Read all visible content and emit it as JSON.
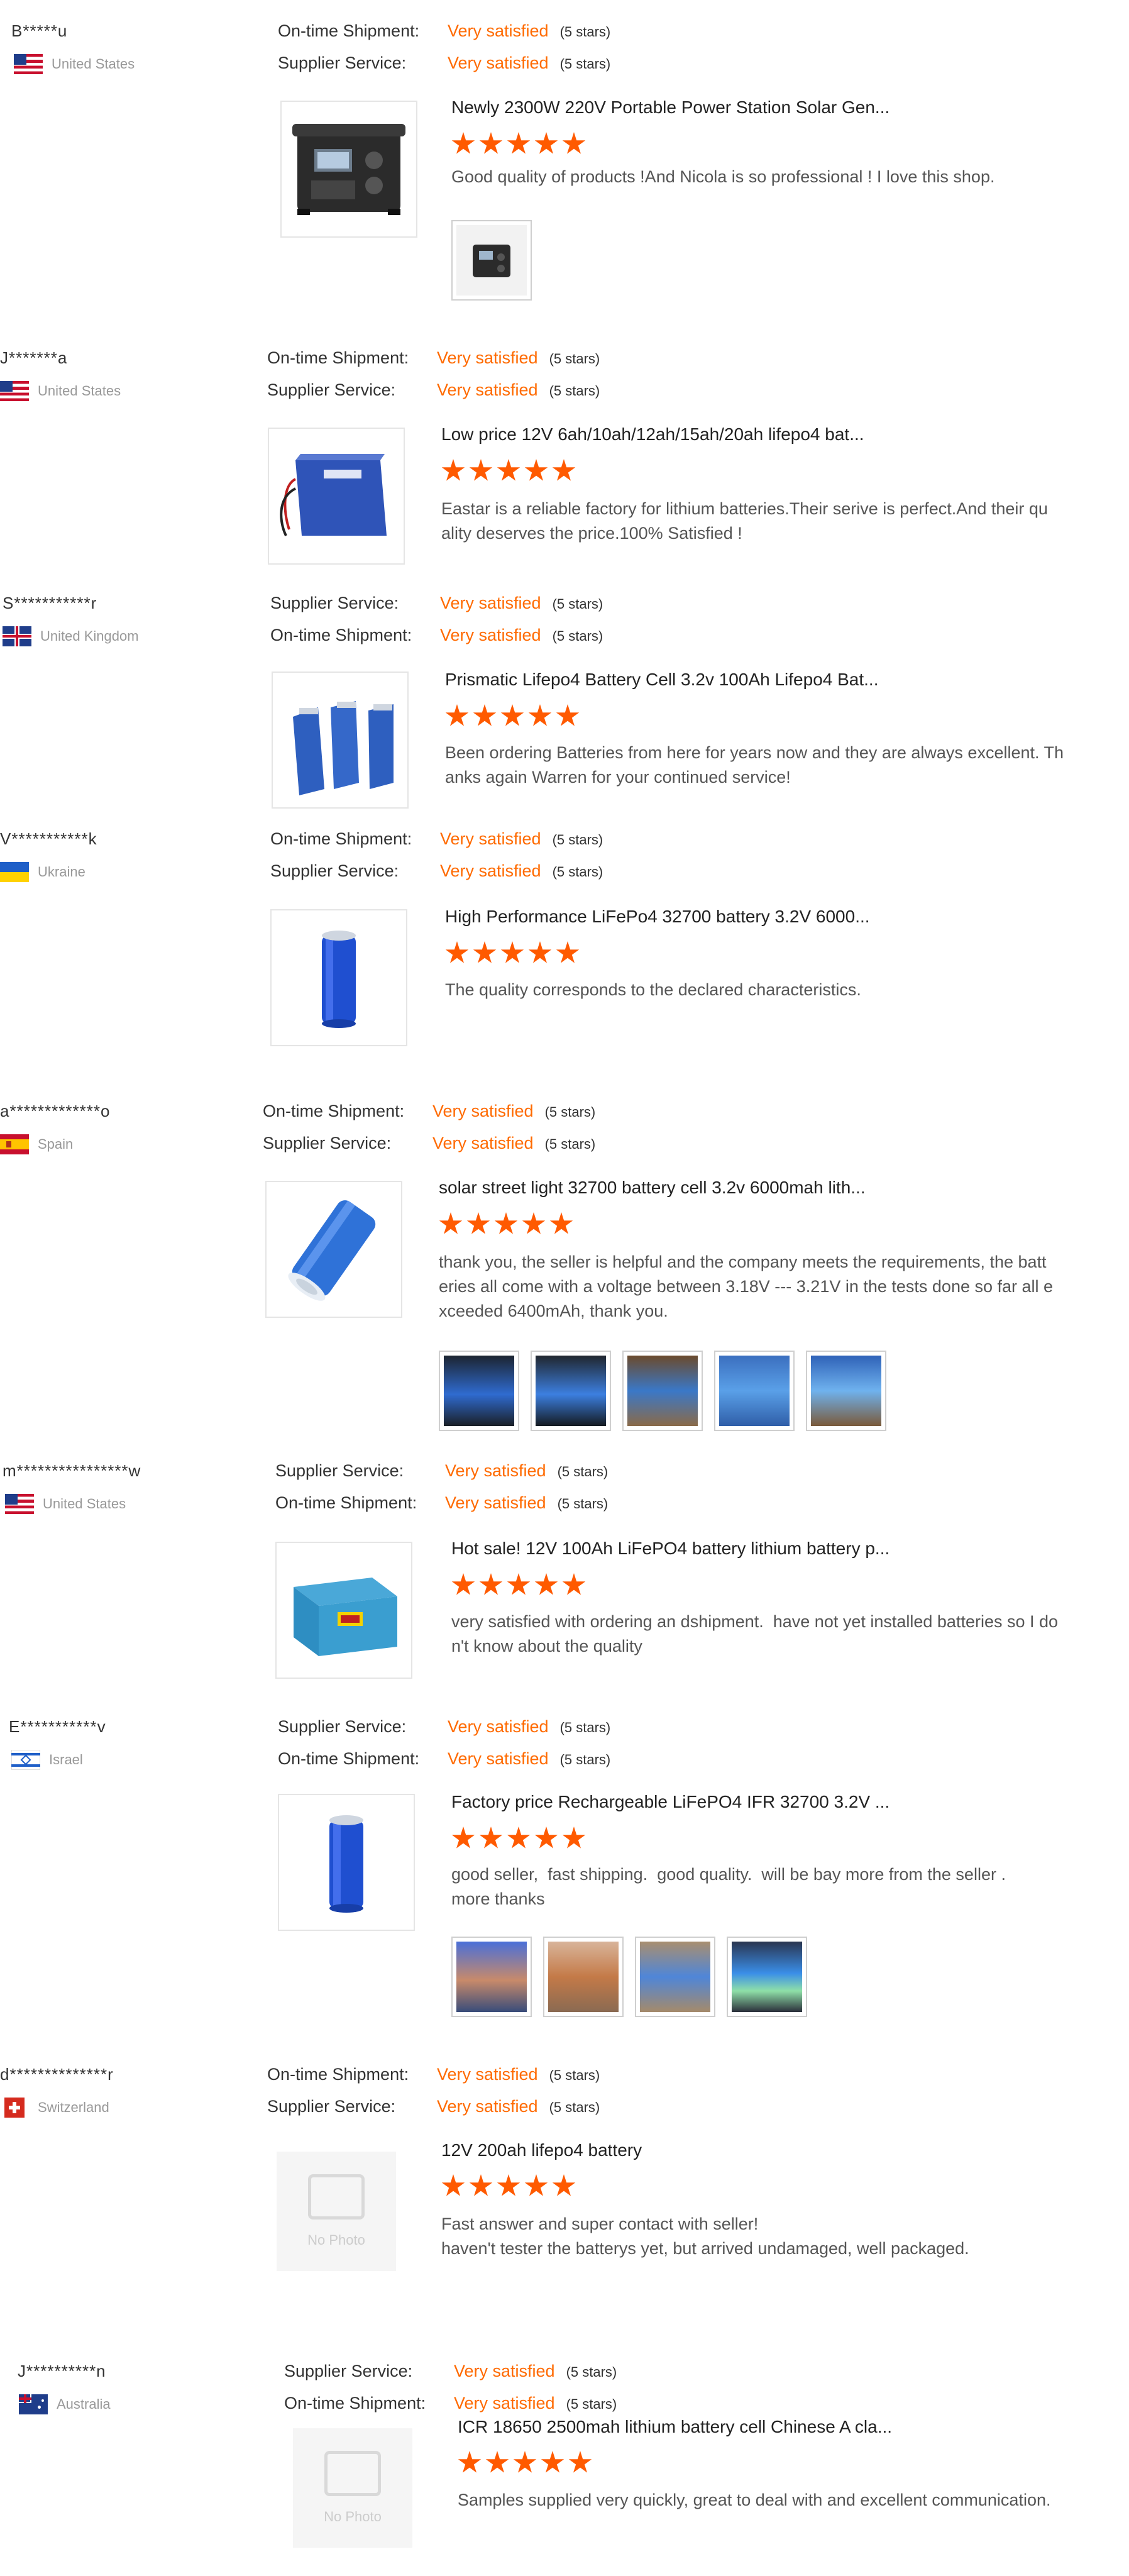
{
  "reviews": [
    {
      "buyer": "B*****u",
      "country": "United States",
      "flag": "us",
      "ratings": [
        {
          "label": "On-time Shipment:",
          "value": "Very satisfied",
          "stars_text": "(5 stars)"
        },
        {
          "label": "Supplier Service:",
          "value": "Very satisfied",
          "stars_text": "(5 stars)"
        }
      ],
      "product_title": "Newly 2300W 220V Portable Power Station Solar Gen...",
      "product_image": "power-station",
      "stars": 5,
      "text": "Good quality of products !And Nicola is so professional ! I love this shop.",
      "photos": [
        "power-station-small"
      ]
    },
    {
      "buyer": "J*******a",
      "country": "United States",
      "flag": "us",
      "ratings": [
        {
          "label": "On-time Shipment:",
          "value": "Very satisfied",
          "stars_text": "(5 stars)"
        },
        {
          "label": "Supplier Service:",
          "value": "Very satisfied",
          "stars_text": "(5 stars)"
        }
      ],
      "product_title": "Low price 12V 6ah/10ah/12ah/15ah/20ah lifepo4 bat...",
      "product_image": "blue-battery-pack",
      "stars": 5,
      "text": "Eastar is a reliable factory for lithium batteries.Their serive is perfect.And their qu\nality deserves the price.100% Satisfied !",
      "photos": []
    },
    {
      "buyer": "S***********r",
      "country": "United Kingdom",
      "flag": "gb",
      "ratings": [
        {
          "label": "Supplier Service:",
          "value": "Very satisfied",
          "stars_text": "(5 stars)"
        },
        {
          "label": "On-time Shipment:",
          "value": "Very satisfied",
          "stars_text": "(5 stars)"
        }
      ],
      "product_title": "Prismatic Lifepo4 Battery Cell 3.2v 100Ah Lifepo4 Bat...",
      "product_image": "prismatic-cells",
      "stars": 5,
      "text": "Been ordering Batteries from here for years now and they are always excellent. Th\nanks again Warren for your continued service!",
      "photos": []
    },
    {
      "buyer": "V***********k",
      "country": "Ukraine",
      "flag": "ua",
      "ratings": [
        {
          "label": "On-time Shipment:",
          "value": "Very satisfied",
          "stars_text": "(5 stars)"
        },
        {
          "label": "Supplier Service:",
          "value": "Very satisfied",
          "stars_text": "(5 stars)"
        }
      ],
      "product_title": "High Performance LiFePo4 32700 battery 3.2V 6000...",
      "product_image": "cylinder-cell",
      "stars": 5,
      "text": "The quality corresponds to the declared characteristics.",
      "photos": []
    },
    {
      "buyer": "a*************o",
      "country": "Spain",
      "flag": "es",
      "ratings": [
        {
          "label": "On-time Shipment:",
          "value": "Very satisfied",
          "stars_text": "(5 stars)"
        },
        {
          "label": "Supplier Service:",
          "value": "Very satisfied",
          "stars_text": "(5 stars)"
        }
      ],
      "product_title": "solar street light 32700 battery cell 3.2v 6000mah lith...",
      "product_image": "cylinder-cell-tilted",
      "stars": 5,
      "text": "thank you, the seller is helpful and the company meets the requirements, the batt\neries all come with a voltage between 3.18V --- 3.21V in the tests done so far all e\nxceeded 6400mAh, thank you.",
      "photos": [
        "tester-photo-1",
        "tester-photo-2",
        "cells-box-photo-1",
        "cells-box-photo-2",
        "cells-box-photo-3"
      ]
    },
    {
      "buyer": "m****************w",
      "country": "United States",
      "flag": "us",
      "ratings": [
        {
          "label": "Supplier Service:",
          "value": "Very satisfied",
          "stars_text": "(5 stars)"
        },
        {
          "label": "On-time Shipment:",
          "value": "Very satisfied",
          "stars_text": "(5 stars)"
        }
      ],
      "product_title": "Hot sale! 12V 100Ah LiFePO4 battery lithium battery p...",
      "product_image": "blue-battery-box",
      "stars": 5,
      "text": "very satisfied with ordering an dshipment.  have not yet installed batteries so I do\nn't know about the quality",
      "photos": []
    },
    {
      "buyer": "E***********v",
      "country": "Israel",
      "flag": "il",
      "ratings": [
        {
          "label": "Supplier Service:",
          "value": "Very satisfied",
          "stars_text": "(5 stars)"
        },
        {
          "label": "On-time Shipment:",
          "value": "Very satisfied",
          "stars_text": "(5 stars)"
        }
      ],
      "product_title": "Factory price Rechargeable LiFePO4 IFR 32700 3.2V ...",
      "product_image": "cylinder-cell",
      "stars": 5,
      "text": "good seller,  fast shipping.  good quality.  will be bay more from the seller .\nmore thanks",
      "photos": [
        "hand-cell-photo",
        "cell-in-hand-photo",
        "cells-row-photo",
        "cells-lit-photo"
      ]
    },
    {
      "buyer": "d**************r",
      "country": "Switzerland",
      "flag": "ch",
      "ratings": [
        {
          "label": "On-time Shipment:",
          "value": "Very satisfied",
          "stars_text": "(5 stars)"
        },
        {
          "label": "Supplier Service:",
          "value": "Very satisfied",
          "stars_text": "(5 stars)"
        }
      ],
      "product_title": "12V 200ah lifepo4 battery",
      "product_image": "no-photo",
      "no_photo_text": "No Photo",
      "stars": 5,
      "text": "Fast answer and super contact with seller!\nhaven't tester the batterys yet, but arrived undamaged, well packaged.",
      "photos": []
    },
    {
      "buyer": "J**********n",
      "country": "Australia",
      "flag": "au",
      "ratings": [
        {
          "label": "Supplier Service:",
          "value": "Very satisfied",
          "stars_text": "(5 stars)"
        },
        {
          "label": "On-time Shipment:",
          "value": "Very satisfied",
          "stars_text": "(5 stars)"
        }
      ],
      "product_title": "ICR 18650 2500mah lithium battery cell Chinese A cla...",
      "product_image": "no-photo",
      "no_photo_text": "No Photo",
      "stars": 5,
      "text": "Samples supplied very quickly, great to deal with and excellent communication.",
      "photos": []
    }
  ],
  "colors": {
    "accent": "#ff6a00",
    "star": "#ff5a00",
    "text": "#333333",
    "muted": "#999999"
  }
}
